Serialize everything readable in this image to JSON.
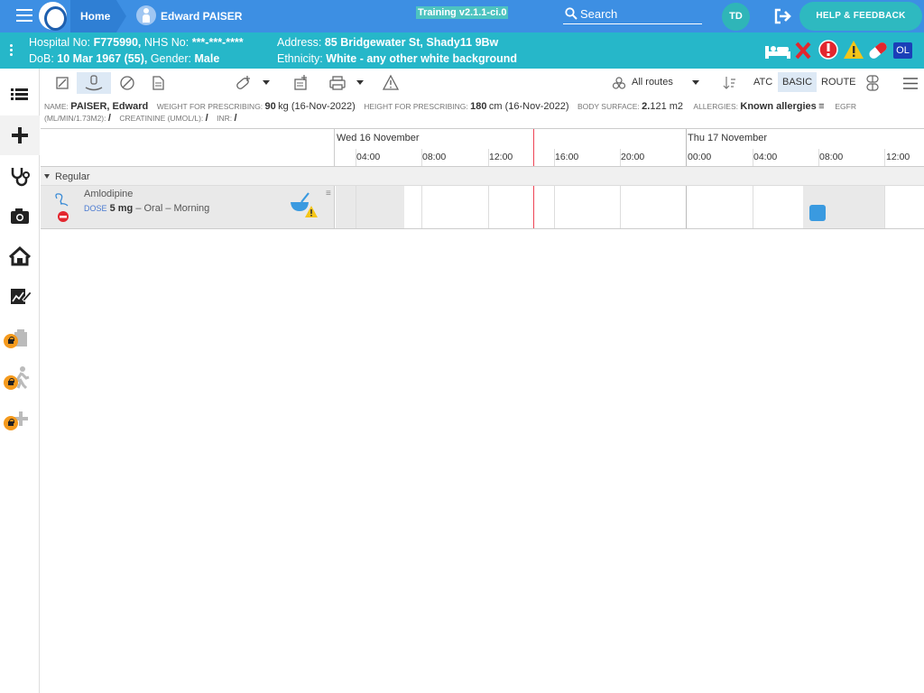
{
  "topbar": {
    "home_label": "Home",
    "patient_name": "Edward PAISER",
    "training_label": "Training v2.1.1-ci.0",
    "search_label": "Search",
    "user_initials": "TD",
    "help_label": "HELP & FEEDBACK"
  },
  "patient_banner": {
    "hospital_no_label": "Hospital No:",
    "hospital_no": "F775990,",
    "nhs_no_label": "NHS No:",
    "nhs_no": "***-***-****",
    "dob_label": "DoB:",
    "dob": "10 Mar 1967 (55),",
    "gender_label": "Gender:",
    "gender": "Male",
    "address_label": "Address:",
    "address": "85 Bridgewater St, Shady11 9Bw",
    "ethnicity_label": "Ethnicity:",
    "ethnicity": "White - any other white background",
    "ol_badge": "OL"
  },
  "toolbar": {
    "routes_label": "All routes",
    "atc_label": "ATC",
    "basic_label": "BASIC",
    "route_label": "ROUTE"
  },
  "info": {
    "name_label": "NAME:",
    "name": "PAISER, Edward",
    "weight_label": "WEIGHT FOR PRESCRIBING:",
    "weight_value": "90",
    "weight_unit": "kg (16-Nov-2022)",
    "height_label": "HEIGHT FOR PRESCRIBING:",
    "height_value": "180",
    "height_unit": "cm (16-Nov-2022)",
    "bsa_label": "BODY SURFACE:",
    "bsa_value": "2.",
    "bsa_rest": "121 m2",
    "allergies_label": "ALLERGIES:",
    "allergies": "Known allergies",
    "egfr_label": "EGFR",
    "egfr_unit_label": "(ML/MIN/1.73M2):",
    "egfr_value": "/",
    "creatinine_label": "CREATININE (UMOL/L):",
    "creatinine_value": "/",
    "inr_label": "INR:",
    "inr_value": "/"
  },
  "timeline": {
    "days": [
      "Wed 16 November",
      "Thu 17 November"
    ],
    "hours": [
      "04:00",
      "08:00",
      "12:00",
      "16:00",
      "20:00",
      "00:00",
      "04:00",
      "08:00",
      "12:00"
    ]
  },
  "group": {
    "label": "Regular"
  },
  "medication": {
    "name": "Amlodipine",
    "dose_label": "DOSE",
    "dose_value": "5 mg",
    "route_time": "– Oral – Morning"
  },
  "colors": {
    "topbar": "#3d8fe3",
    "banner": "#26b7c9",
    "dose_box": "#3a9ae0",
    "now_line": "#e44455"
  }
}
